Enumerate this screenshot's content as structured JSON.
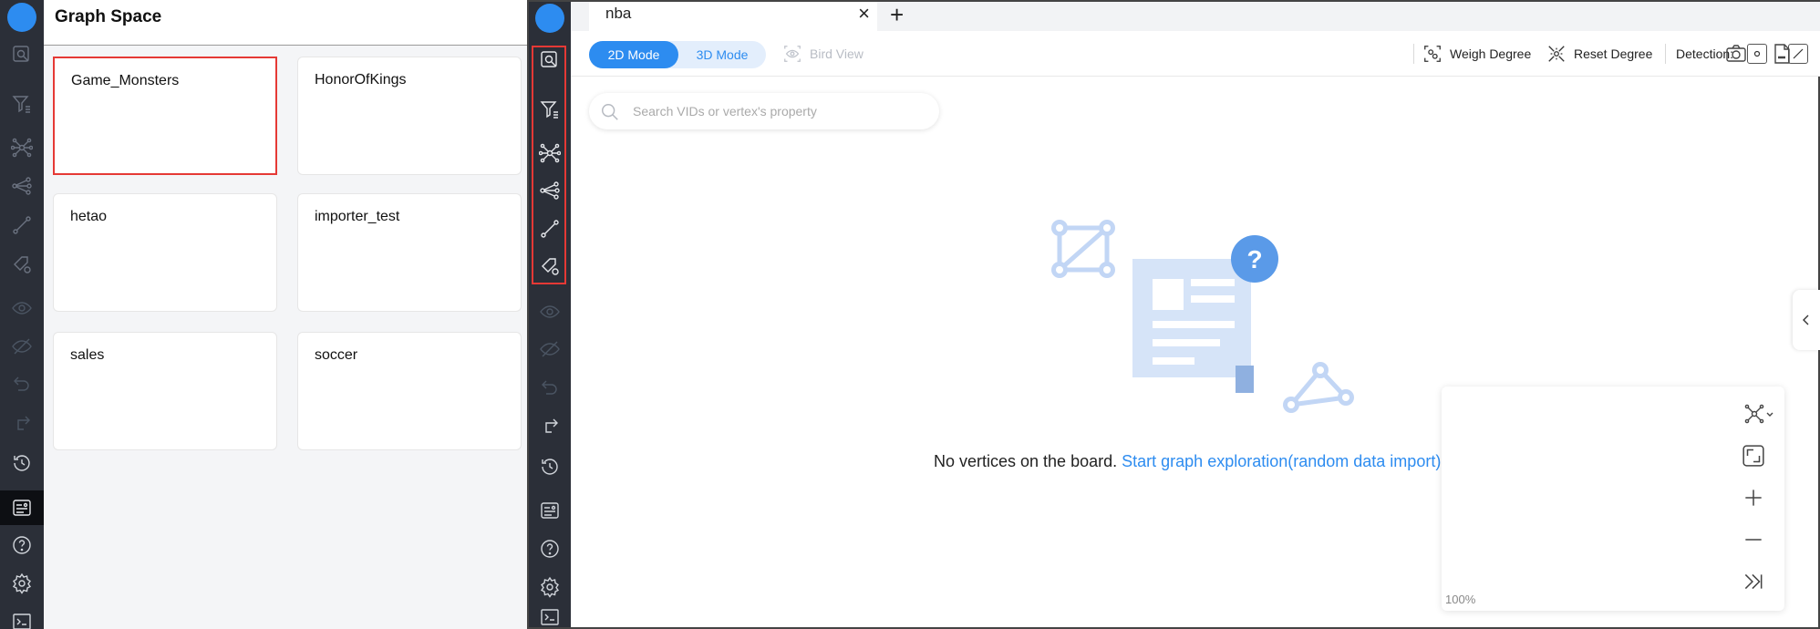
{
  "left_app": {
    "header_title": "Graph Space",
    "graph_spaces": [
      "Game_Monsters",
      "HonorOfKings",
      "hetao",
      "importer_test",
      "sales",
      "soccer"
    ]
  },
  "right_app": {
    "tab": {
      "label": "nba",
      "close_glyph": "×",
      "add_glyph": "+"
    },
    "toolbar": {
      "mode_2d": "2D Mode",
      "mode_3d": "3D Mode",
      "bird_view": "Bird View",
      "weigh_degree": "Weigh Degree",
      "reset_degree": "Reset Degree",
      "detection_label": "Detection:"
    },
    "search": {
      "placeholder": "Search VIDs or vertex's property"
    },
    "empty_state": {
      "message": "No vertices on the board.",
      "link": "Start graph exploration(random data import)"
    },
    "zoom_level": "100%"
  },
  "colors": {
    "accent": "#2d8cf0",
    "sidebar": "#2b2f38",
    "highlight_border": "#e53935"
  }
}
